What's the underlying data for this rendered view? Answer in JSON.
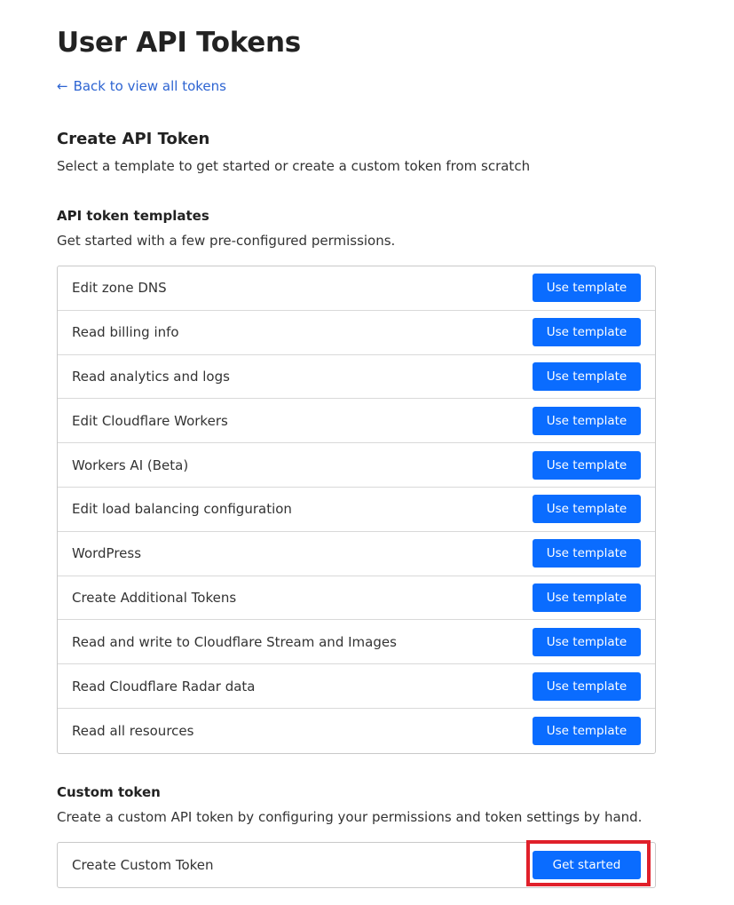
{
  "page": {
    "title": "User API Tokens",
    "back_link": "Back to view all tokens",
    "back_icon": "arrow-left-icon"
  },
  "create": {
    "title": "Create API Token",
    "description": "Select a template to get started or create a custom token from scratch"
  },
  "templates": {
    "title": "API token templates",
    "description": "Get started with a few pre-configured permissions.",
    "button_label": "Use template",
    "items": [
      {
        "label": "Edit zone DNS"
      },
      {
        "label": "Read billing info"
      },
      {
        "label": "Read analytics and logs"
      },
      {
        "label": "Edit Cloudflare Workers"
      },
      {
        "label": "Workers AI (Beta)"
      },
      {
        "label": "Edit load balancing configuration"
      },
      {
        "label": "WordPress"
      },
      {
        "label": "Create Additional Tokens"
      },
      {
        "label": "Read and write to Cloudflare Stream and Images"
      },
      {
        "label": "Read Cloudflare Radar data"
      },
      {
        "label": "Read all resources"
      }
    ]
  },
  "custom": {
    "title": "Custom token",
    "description": "Create a custom API token by configuring your permissions and token settings by hand.",
    "row_label": "Create Custom Token",
    "button_label": "Get started"
  },
  "colors": {
    "primary_button": "#0a6cff",
    "link": "#2d64d2",
    "highlight": "#e0202a"
  }
}
